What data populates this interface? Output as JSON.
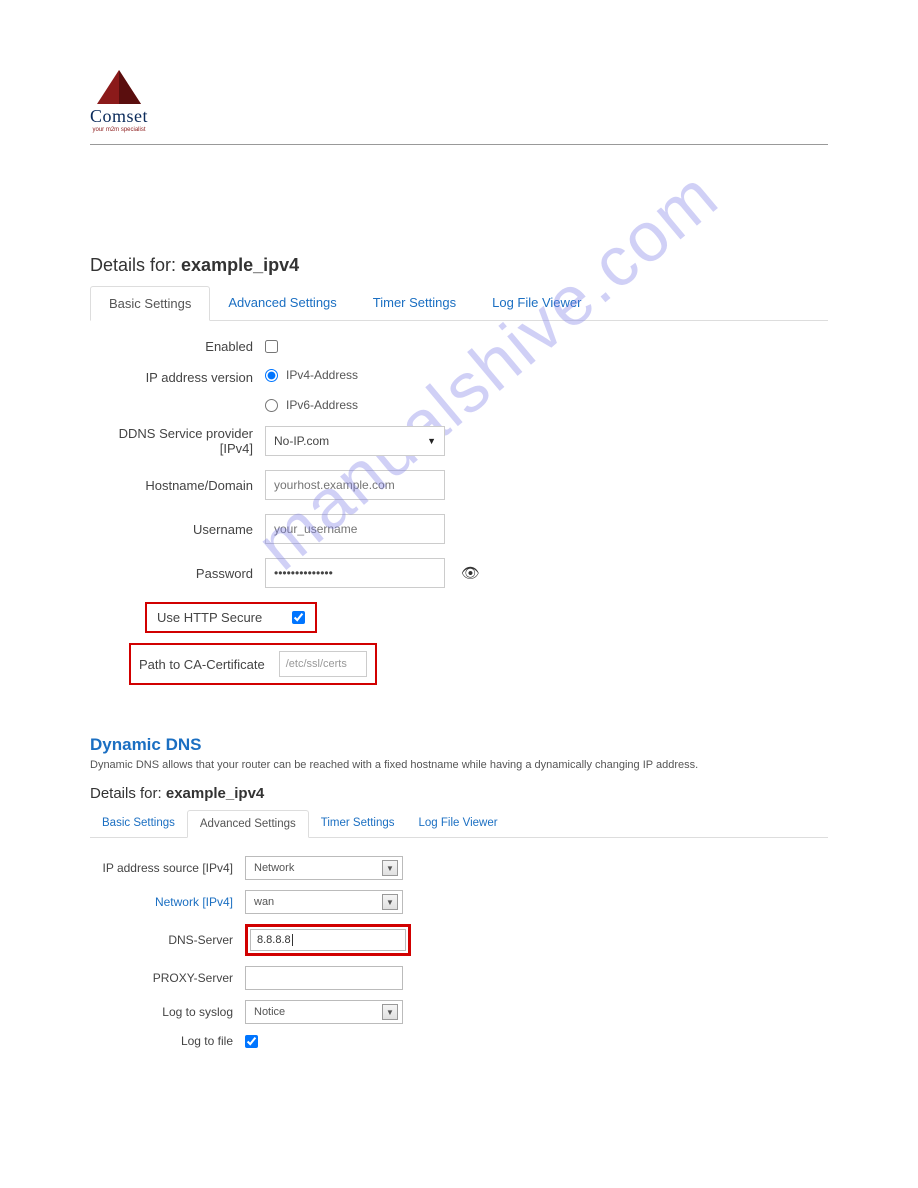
{
  "logo": {
    "name": "Comset",
    "tagline": "your m2m specialist"
  },
  "watermark": "manualshive.com",
  "panel1": {
    "title_prefix": "Details for: ",
    "title_name": "example_ipv4",
    "tabs": [
      "Basic Settings",
      "Advanced Settings",
      "Timer Settings",
      "Log File Viewer"
    ],
    "active_tab": 0,
    "fields": {
      "enabled_label": "Enabled",
      "ipver_label": "IP address version",
      "ipver_opt1": "IPv4-Address",
      "ipver_opt2": "IPv6-Address",
      "provider_label": "DDNS Service provider [IPv4]",
      "provider_value": "No-IP.com",
      "hostname_label": "Hostname/Domain",
      "hostname_placeholder": "yourhost.example.com",
      "username_label": "Username",
      "username_placeholder": "your_username",
      "password_label": "Password",
      "password_value": "••••••••••••••",
      "httpsecure_label": "Use HTTP Secure",
      "cacert_label": "Path to CA-Certificate",
      "cacert_value": "/etc/ssl/certs"
    }
  },
  "panel2": {
    "heading": "Dynamic DNS",
    "description": "Dynamic DNS allows that your router can be reached with a fixed hostname while having a dynamically changing IP address.",
    "title_prefix": "Details for: ",
    "title_name": "example_ipv4",
    "tabs": [
      "Basic Settings",
      "Advanced Settings",
      "Timer Settings",
      "Log File Viewer"
    ],
    "active_tab": 1,
    "fields": {
      "ipsrc_label": "IP address source [IPv4]",
      "ipsrc_value": "Network",
      "network_label": "Network [IPv4]",
      "network_value": "wan",
      "dns_label": "DNS-Server",
      "dns_value": "8.8.8.8",
      "proxy_label": "PROXY-Server",
      "syslog_label": "Log to syslog",
      "syslog_value": "Notice",
      "logfile_label": "Log to file"
    }
  }
}
